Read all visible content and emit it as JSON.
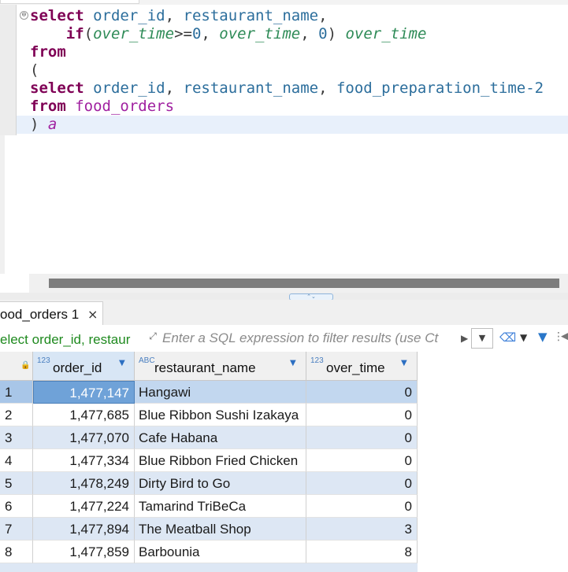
{
  "editor": {
    "lines": [
      [
        [
          "kw",
          "select"
        ],
        [
          "sp",
          " "
        ],
        [
          "id",
          "order_id"
        ],
        [
          "sp",
          ", "
        ],
        [
          "id",
          "restaurant_name"
        ],
        [
          "sp",
          ","
        ]
      ],
      [
        [
          "sp",
          "    "
        ],
        [
          "kw",
          "if"
        ],
        [
          "sp",
          "("
        ],
        [
          "it",
          "over_time"
        ],
        [
          "sp",
          ">="
        ],
        [
          "lit",
          "0"
        ],
        [
          "sp",
          ", "
        ],
        [
          "it",
          "over_time"
        ],
        [
          "sp",
          ", "
        ],
        [
          "lit",
          "0"
        ],
        [
          "sp",
          ") "
        ],
        [
          "it",
          "over_time"
        ]
      ],
      [
        [
          "kw",
          "from"
        ]
      ],
      [
        [
          "sp",
          "("
        ]
      ],
      [
        [
          "kw",
          "select"
        ],
        [
          "sp",
          " "
        ],
        [
          "id",
          "order_id"
        ],
        [
          "sp",
          ", "
        ],
        [
          "id",
          "restaurant_name"
        ],
        [
          "sp",
          ", "
        ],
        [
          "id",
          "food_preparation_time-2"
        ]
      ],
      [
        [
          "kw",
          "from"
        ],
        [
          "sp",
          " "
        ],
        [
          "tbl",
          "food_orders"
        ]
      ],
      [
        [
          "sp",
          ") "
        ],
        [
          "alias",
          "a"
        ]
      ]
    ],
    "fold_marker": "⊖"
  },
  "results": {
    "tab_label": "ood_orders 1",
    "tab_close": "×",
    "query_snippet": "elect order_id, restaur",
    "filter_placeholder": "Enter a SQL expression to filter results (use Ct",
    "columns": [
      {
        "type_badge": "123",
        "label": "order_id"
      },
      {
        "type_badge": "ABC",
        "label": "restaurant_name"
      },
      {
        "type_badge": "123",
        "label": "over_time"
      }
    ],
    "rows": [
      {
        "num": "1",
        "order_id": "1,477,147",
        "restaurant_name": "Hangawi",
        "over_time": "0"
      },
      {
        "num": "2",
        "order_id": "1,477,685",
        "restaurant_name": "Blue Ribbon Sushi Izakaya",
        "over_time": "0"
      },
      {
        "num": "3",
        "order_id": "1,477,070",
        "restaurant_name": "Cafe Habana",
        "over_time": "0"
      },
      {
        "num": "4",
        "order_id": "1,477,334",
        "restaurant_name": "Blue Ribbon Fried Chicken",
        "over_time": "0"
      },
      {
        "num": "5",
        "order_id": "1,478,249",
        "restaurant_name": "Dirty Bird to Go",
        "over_time": "0"
      },
      {
        "num": "6",
        "order_id": "1,477,224",
        "restaurant_name": "Tamarind TriBeCa",
        "over_time": "0"
      },
      {
        "num": "7",
        "order_id": "1,477,894",
        "restaurant_name": "The Meatball Shop",
        "over_time": "3"
      },
      {
        "num": "8",
        "order_id": "1,477,859",
        "restaurant_name": "Barbounia",
        "over_time": "8"
      }
    ]
  },
  "icons": {
    "expand": "⤢",
    "run": "▶",
    "history": "▼",
    "eraser": "⌫",
    "dropdown": "▼",
    "funnel": "▼",
    "more": "⋮",
    "left_arrow": "◀",
    "sort": "▼",
    "lock": "🔒",
    "splitter": "⌃⌄"
  }
}
